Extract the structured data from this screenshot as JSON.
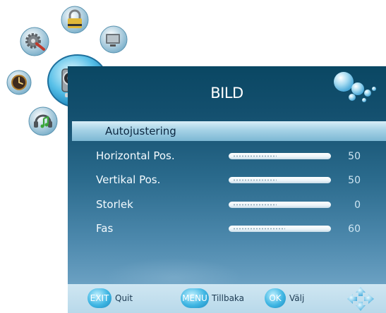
{
  "menu": {
    "title": "BILD",
    "items": [
      {
        "label": "Autojustering",
        "selected": true
      },
      {
        "label": "Horizontal Pos.",
        "value": "50",
        "level": 0.5
      },
      {
        "label": "Vertikal Pos.",
        "value": "50",
        "level": 0.5
      },
      {
        "label": "Storlek",
        "value": "0",
        "level": 0.5
      },
      {
        "label": "Fas",
        "value": "60",
        "level": 0.6
      }
    ]
  },
  "footer": {
    "exit_key": "EXIT",
    "exit_label": "Quit",
    "menu_key": "MENU",
    "menu_label": "Tillbaka",
    "ok_key": "OK",
    "ok_label": "Välj"
  },
  "icons": [
    "lock-icon",
    "settings-gear-icon",
    "pc-monitor-icon",
    "camera-picture-icon",
    "clock-icon",
    "music-sound-icon",
    "bubbles-logo-icon",
    "arrow-pad-icon"
  ],
  "colors": {
    "panel_dark": "#0a4763",
    "panel_light": "#7ab0cf",
    "highlight": "#a5d2e6",
    "footer": "#c3e0ee",
    "key_blue": "#3fb6e3"
  }
}
